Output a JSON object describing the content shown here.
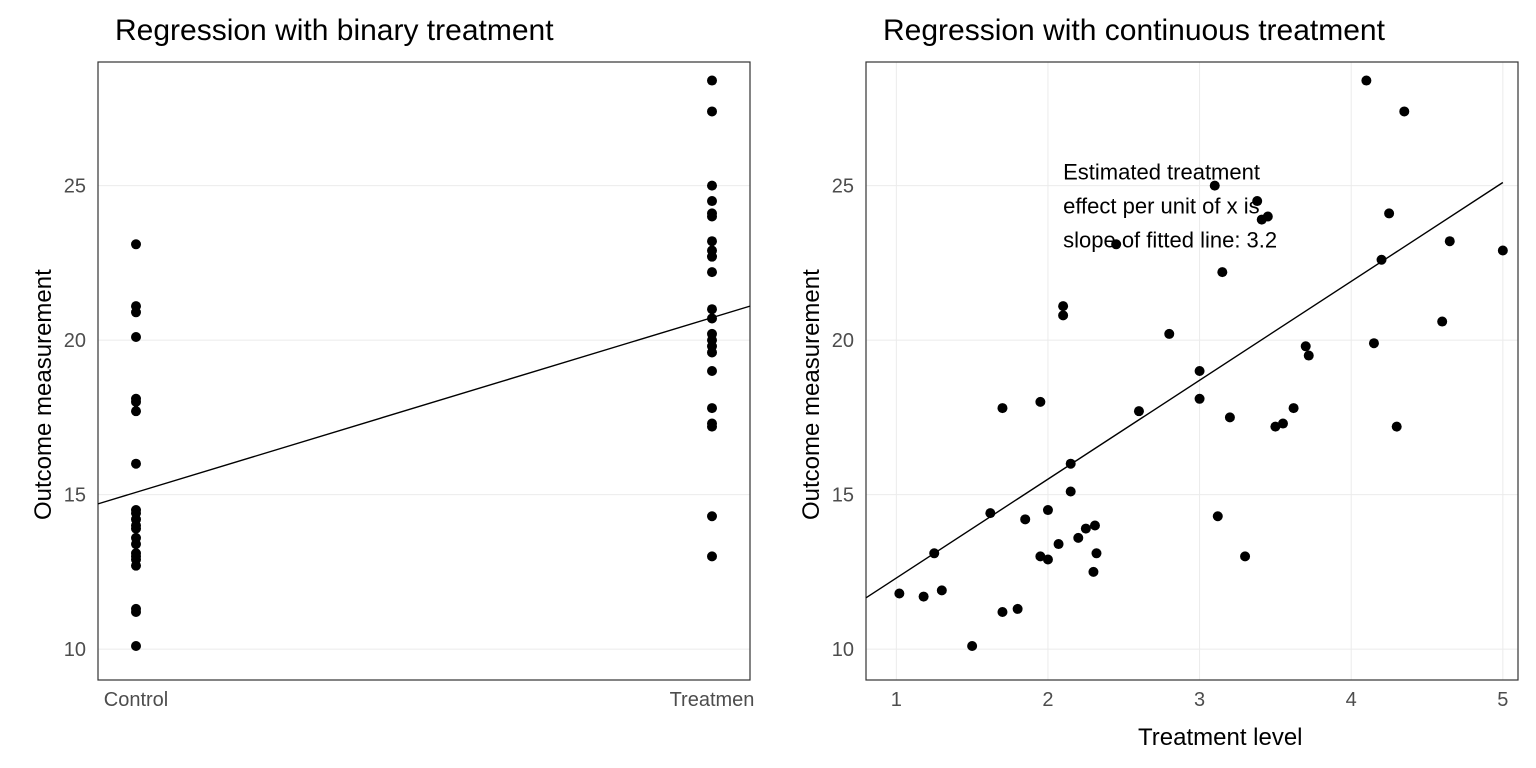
{
  "chart_data": [
    {
      "type": "scatter",
      "title": "Regression with binary treatment",
      "xlabel": "",
      "ylabel": "Outcome measurement",
      "x_type": "categorical",
      "categories": [
        "Control",
        "Treatmen"
      ],
      "ylim": [
        9,
        29
      ],
      "y_ticks": [
        10,
        15,
        20,
        25
      ],
      "series": [
        {
          "name": "Control",
          "x": 0,
          "y": [
            10.1,
            11.2,
            11.3,
            12.7,
            12.9,
            13.0,
            13.1,
            13.4,
            13.6,
            13.9,
            14.0,
            14.2,
            14.4,
            14.5,
            16.0,
            17.7,
            18.0,
            18.1,
            20.1,
            20.9,
            21.1,
            23.1
          ]
        },
        {
          "name": "Treatmen",
          "x": 1,
          "y": [
            13.0,
            14.3,
            17.2,
            17.3,
            17.8,
            19.0,
            19.6,
            19.8,
            20.0,
            20.2,
            20.7,
            21.0,
            22.2,
            22.7,
            22.9,
            23.2,
            24.0,
            24.1,
            24.5,
            25.0,
            27.4,
            28.4
          ]
        }
      ],
      "fit_line": {
        "x": [
          0,
          1
        ],
        "y": [
          14.7,
          21.1
        ]
      }
    },
    {
      "type": "scatter",
      "title": "Regression with continuous treatment",
      "xlabel": "Treatment level",
      "ylabel": "Outcome measurement",
      "xlim": [
        0.8,
        5.1
      ],
      "ylim": [
        9,
        29
      ],
      "x_ticks": [
        1,
        2,
        3,
        4,
        5
      ],
      "y_ticks": [
        10,
        15,
        20,
        25
      ],
      "points": [
        {
          "x": 1.02,
          "y": 11.8
        },
        {
          "x": 1.18,
          "y": 11.7
        },
        {
          "x": 1.25,
          "y": 13.1
        },
        {
          "x": 1.3,
          "y": 11.9
        },
        {
          "x": 1.5,
          "y": 10.1
        },
        {
          "x": 1.62,
          "y": 14.4
        },
        {
          "x": 1.7,
          "y": 11.2
        },
        {
          "x": 1.7,
          "y": 17.8
        },
        {
          "x": 1.8,
          "y": 11.3
        },
        {
          "x": 1.85,
          "y": 14.2
        },
        {
          "x": 1.95,
          "y": 13.0
        },
        {
          "x": 1.95,
          "y": 18.0
        },
        {
          "x": 2.0,
          "y": 12.9
        },
        {
          "x": 2.0,
          "y": 14.5
        },
        {
          "x": 2.07,
          "y": 13.4
        },
        {
          "x": 2.1,
          "y": 20.8
        },
        {
          "x": 2.1,
          "y": 21.1
        },
        {
          "x": 2.15,
          "y": 15.1
        },
        {
          "x": 2.15,
          "y": 16.0
        },
        {
          "x": 2.2,
          "y": 13.6
        },
        {
          "x": 2.25,
          "y": 13.9
        },
        {
          "x": 2.3,
          "y": 12.5
        },
        {
          "x": 2.31,
          "y": 14.0
        },
        {
          "x": 2.32,
          "y": 13.1
        },
        {
          "x": 2.45,
          "y": 23.1
        },
        {
          "x": 2.6,
          "y": 17.7
        },
        {
          "x": 2.8,
          "y": 20.2
        },
        {
          "x": 3.0,
          "y": 19.0
        },
        {
          "x": 3.0,
          "y": 18.1
        },
        {
          "x": 3.1,
          "y": 25.0
        },
        {
          "x": 3.12,
          "y": 14.3
        },
        {
          "x": 3.15,
          "y": 22.2
        },
        {
          "x": 3.2,
          "y": 17.5
        },
        {
          "x": 3.3,
          "y": 13.0
        },
        {
          "x": 3.38,
          "y": 24.5
        },
        {
          "x": 3.41,
          "y": 23.9
        },
        {
          "x": 3.45,
          "y": 24.0
        },
        {
          "x": 3.5,
          "y": 17.2
        },
        {
          "x": 3.55,
          "y": 17.3
        },
        {
          "x": 3.62,
          "y": 17.8
        },
        {
          "x": 3.7,
          "y": 19.8
        },
        {
          "x": 3.72,
          "y": 19.5
        },
        {
          "x": 4.1,
          "y": 28.4
        },
        {
          "x": 4.15,
          "y": 19.9
        },
        {
          "x": 4.2,
          "y": 22.6
        },
        {
          "x": 4.25,
          "y": 24.1
        },
        {
          "x": 4.3,
          "y": 17.2
        },
        {
          "x": 4.35,
          "y": 27.4
        },
        {
          "x": 4.6,
          "y": 20.6
        },
        {
          "x": 4.65,
          "y": 23.2
        },
        {
          "x": 5.0,
          "y": 22.9
        }
      ],
      "fit_line": {
        "intercept": 9.1,
        "slope": 3.2,
        "x": [
          0.8,
          5.0
        ]
      },
      "annotation": {
        "lines": [
          "Estimated treatment",
          "effect per unit of x is",
          "slope of fitted line: 3.2"
        ],
        "x": 2.1,
        "y_top": 25.2
      }
    }
  ]
}
